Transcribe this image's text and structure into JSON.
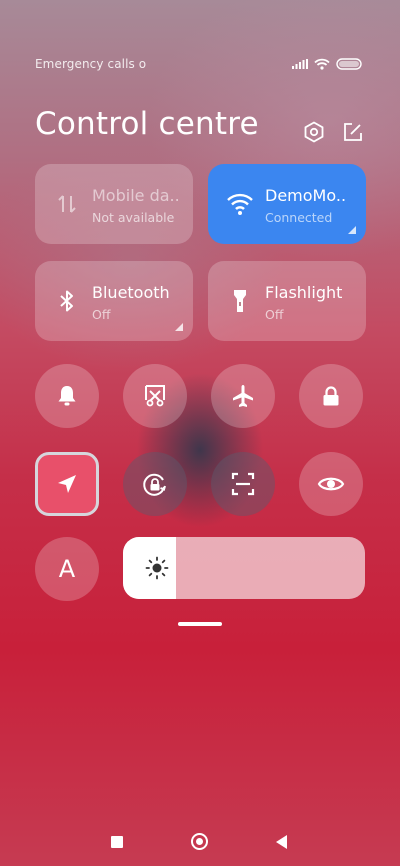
{
  "status_bar": {
    "carrier_text": "Emergency calls o",
    "icons": [
      "signal-icon",
      "wifi-icon",
      "battery-icon"
    ]
  },
  "header": {
    "title": "Control centre",
    "icons": [
      "settings-icon",
      "edit-icon"
    ]
  },
  "tiles": [
    {
      "label": "Mobile da..",
      "sub": "Not available",
      "icon": "mobile-data-icon",
      "active": false
    },
    {
      "label": "DemoMo..",
      "sub": "Connected",
      "icon": "wifi-icon",
      "active": true
    },
    {
      "label": "Bluetooth",
      "sub": "Off",
      "icon": "bluetooth-icon",
      "active": false
    },
    {
      "label": "Flashlight",
      "sub": "Off",
      "icon": "flashlight-icon",
      "active": false
    }
  ],
  "toggles": [
    {
      "icon": "bell-icon",
      "active": false
    },
    {
      "icon": "screenshot-icon",
      "active": false
    },
    {
      "icon": "airplane-icon",
      "active": false
    },
    {
      "icon": "lock-icon",
      "active": false
    },
    {
      "icon": "location-icon",
      "active": true
    },
    {
      "icon": "rotation-lock-icon",
      "active": false
    },
    {
      "icon": "scan-icon",
      "active": false
    },
    {
      "icon": "eye-icon",
      "active": false
    }
  ],
  "auto_brightness": {
    "label": "A"
  },
  "brightness": {
    "level": 0.22,
    "icon": "sun-icon"
  },
  "nav_bar": {
    "buttons": [
      "recents-button",
      "home-button",
      "back-button"
    ]
  },
  "colors": {
    "accent": "#3b86f0",
    "location_active": "#e8506a"
  }
}
